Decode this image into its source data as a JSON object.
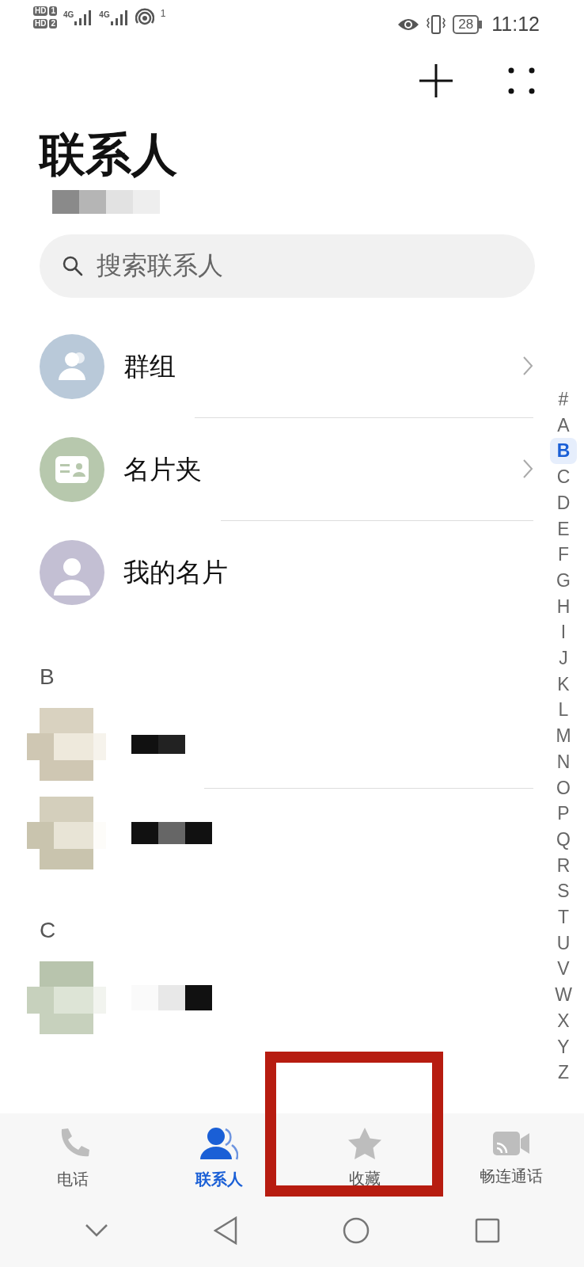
{
  "status_bar": {
    "sim_badges": [
      {
        "label": "HD",
        "slot": "1"
      },
      {
        "label": "HD",
        "slot": "2"
      }
    ],
    "networks": [
      "4G",
      "4G"
    ],
    "hotspot_count": "1",
    "battery": "28",
    "time": "11:12"
  },
  "title": "联系人",
  "subtitle": {
    "kind": "redacted"
  },
  "search": {
    "placeholder": "搜索联系人"
  },
  "entries": [
    {
      "label": "群组",
      "kind": "group",
      "color": "#b9c9d9",
      "chevron": true
    },
    {
      "label": "名片夹",
      "kind": "card",
      "color": "#b7c8ad",
      "chevron": true
    },
    {
      "label": "我的名片",
      "kind": "person",
      "color": "#c3bfd3",
      "chevron": false
    }
  ],
  "sections": [
    {
      "letter": "B",
      "contacts": [
        {
          "kind": "redacted"
        },
        {
          "kind": "redacted"
        }
      ]
    },
    {
      "letter": "C",
      "contacts": [
        {
          "kind": "redacted"
        }
      ]
    }
  ],
  "index": [
    {
      "label": "#",
      "selected": false
    },
    {
      "label": "A",
      "selected": false
    },
    {
      "label": "B",
      "selected": true
    },
    {
      "label": "C",
      "selected": false
    },
    {
      "label": "D",
      "selected": false
    },
    {
      "label": "E",
      "selected": false
    },
    {
      "label": "F",
      "selected": false
    },
    {
      "label": "G",
      "selected": false
    },
    {
      "label": "H",
      "selected": false
    },
    {
      "label": "I",
      "selected": false
    },
    {
      "label": "J",
      "selected": false
    },
    {
      "label": "K",
      "selected": false
    },
    {
      "label": "L",
      "selected": false
    },
    {
      "label": "M",
      "selected": false
    },
    {
      "label": "N",
      "selected": false
    },
    {
      "label": "O",
      "selected": false
    },
    {
      "label": "P",
      "selected": false
    },
    {
      "label": "Q",
      "selected": false
    },
    {
      "label": "R",
      "selected": false
    },
    {
      "label": "S",
      "selected": false
    },
    {
      "label": "T",
      "selected": false
    },
    {
      "label": "U",
      "selected": false
    },
    {
      "label": "V",
      "selected": false
    },
    {
      "label": "W",
      "selected": false
    },
    {
      "label": "X",
      "selected": false
    },
    {
      "label": "Y",
      "selected": false
    },
    {
      "label": "Z",
      "selected": false
    }
  ],
  "tabs": [
    {
      "label": "电话",
      "kind": "phone",
      "selected": false,
      "highlighted": false
    },
    {
      "label": "联系人",
      "kind": "contacts",
      "selected": true,
      "highlighted": false
    },
    {
      "label": "收藏",
      "kind": "star",
      "selected": false,
      "highlighted": true
    },
    {
      "label": "畅连通话",
      "kind": "video",
      "selected": false,
      "highlighted": false
    }
  ]
}
